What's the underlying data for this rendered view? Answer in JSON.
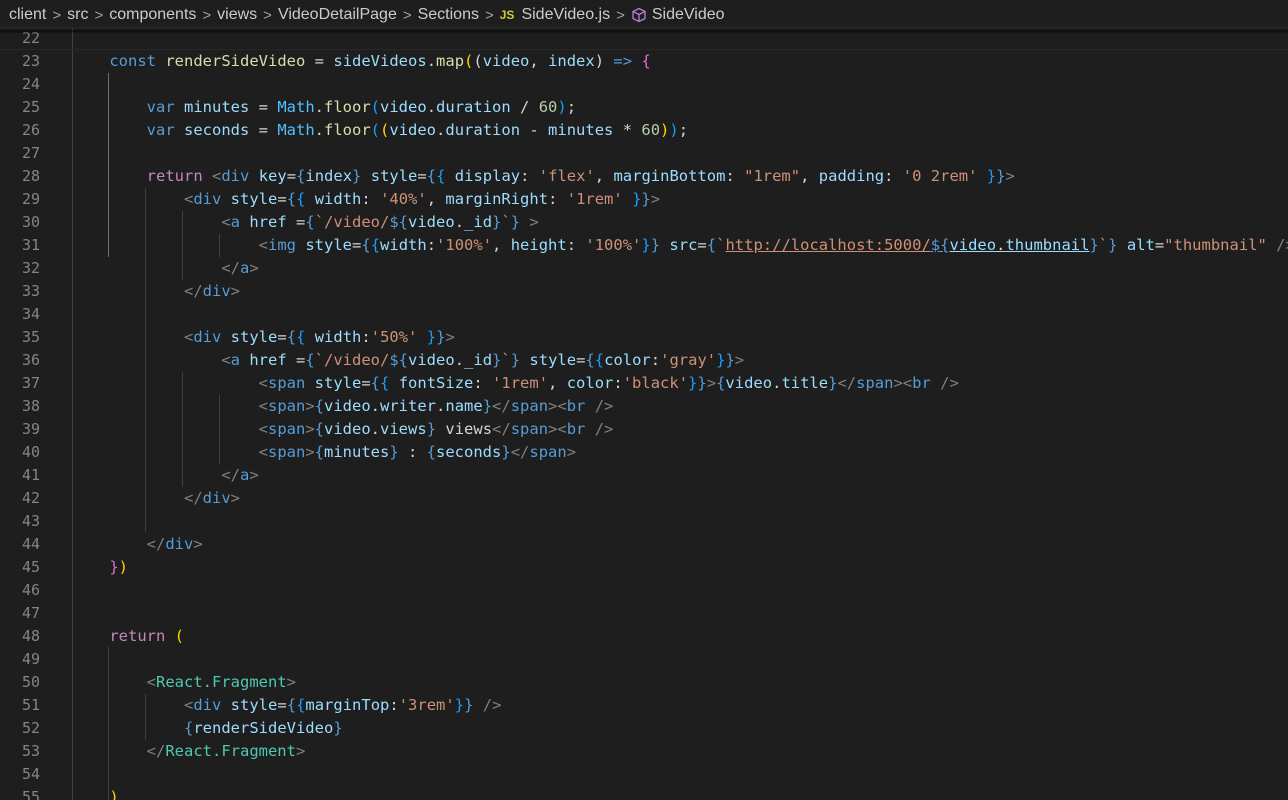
{
  "breadcrumb": {
    "items": [
      "client",
      "src",
      "components",
      "views",
      "VideoDetailPage",
      "Sections"
    ],
    "file_badge": "JS",
    "file": "SideVideo.js",
    "symbol": "SideVideo",
    "separator": ">"
  },
  "editor": {
    "line_numbers": [
      "22",
      "23",
      "24",
      "25",
      "26",
      "27",
      "28",
      "29",
      "30",
      "31",
      "32",
      "33",
      "34",
      "35",
      "36",
      "37",
      "38",
      "39",
      "40",
      "41",
      "42",
      "43",
      "44",
      "45",
      "46",
      "47",
      "48",
      "49",
      "50",
      "51",
      "52",
      "53",
      "54",
      "55"
    ],
    "colors": {
      "background": "#1e1e1e",
      "keyword": "#569cd6",
      "string": "#ce9178",
      "function": "#dcdcaa",
      "variable": "#9cdcfe",
      "component": "#4ec9b0"
    }
  }
}
